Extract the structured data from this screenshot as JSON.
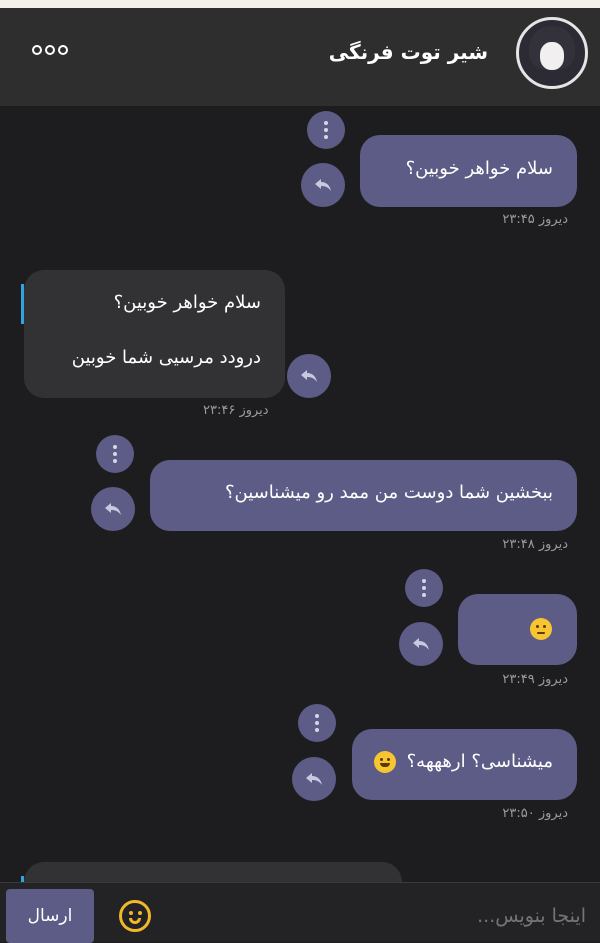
{
  "header": {
    "contact_name": "شیر توت فرنگی"
  },
  "messages": [
    {
      "direction": "out",
      "text": "سلام خواهر خوبین؟",
      "time": "دیروز ۲۳:۴۵"
    },
    {
      "direction": "in",
      "quoted_text": "سلام خواهر خوبین؟",
      "text": "درودد مرسیی شما خوبین",
      "time": "دیروز ۲۳:۴۶"
    },
    {
      "direction": "out",
      "text": "ببخشین شما دوست من ممد رو میشناسین؟",
      "time": "دیروز ۲۳:۴۸"
    },
    {
      "direction": "out",
      "text": "",
      "emoji": "slightly-smiling-face",
      "time": "دیروز ۲۳:۴۹"
    },
    {
      "direction": "out",
      "text": "میشناسی؟ ارهههه؟",
      "emoji": "grinning-face",
      "time": "دیروز ۲۳:۵۰"
    }
  ],
  "composer": {
    "placeholder": "اینجا بنویس...",
    "send_label": "ارسال"
  },
  "colors": {
    "outgoing_bubble": "#5d5c86",
    "incoming_bubble": "#323234",
    "background": "#1d1d1f",
    "quote_accent": "#2ea6df",
    "emoji_accent": "#f1b929"
  }
}
